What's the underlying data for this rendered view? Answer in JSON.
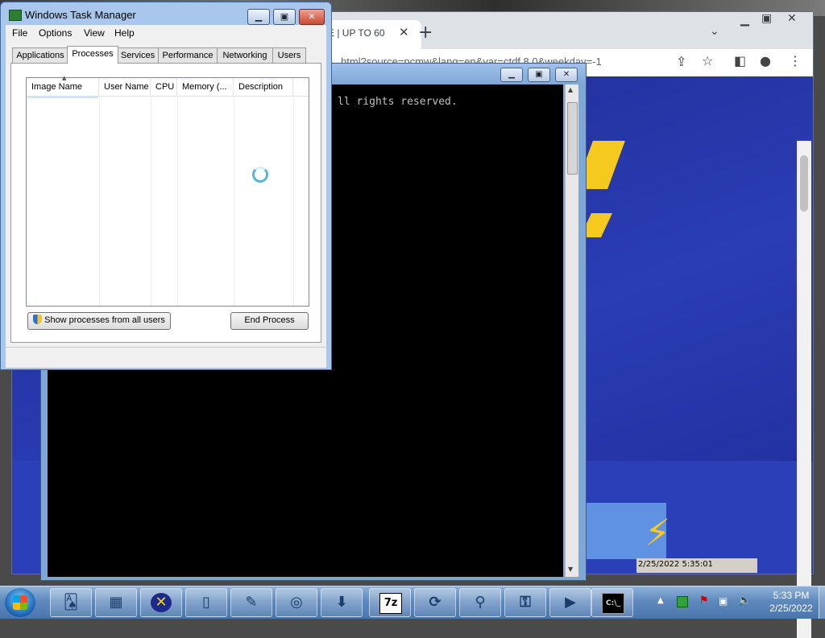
{
  "taskmanager": {
    "title": "Windows Task Manager",
    "menu": [
      "File",
      "Options",
      "View",
      "Help"
    ],
    "tabs": [
      "Applications",
      "Processes",
      "Services",
      "Performance",
      "Networking",
      "Users"
    ],
    "active_tab": "Processes",
    "columns": [
      "Image Name",
      "User Name",
      "CPU",
      "Memory (...",
      "Description"
    ],
    "show_all_label": "Show processes from all users",
    "end_process_label": "End Process"
  },
  "browser": {
    "tab_title": "E | UP TO 60",
    "url": "html?source=pcmw&lang=en&var=ctdf.8.0&weekday=-1"
  },
  "cmd": {
    "text": "ll rights reserved."
  },
  "statusline": {
    "text": "2/25/2022 5:35:01"
  },
  "taskbar": {
    "time": "5:33 PM",
    "date": "2/25/2022",
    "apps": [
      {
        "name": "solitaire-icon",
        "glyph": "🂡"
      },
      {
        "name": "security-center-icon",
        "glyph": "▦"
      },
      {
        "name": "xming-icon",
        "glyph": "✕"
      },
      {
        "name": "documents-icon",
        "glyph": "▯"
      },
      {
        "name": "notepad-plus-icon",
        "glyph": "✎"
      },
      {
        "name": "tool-icon",
        "glyph": "◎"
      },
      {
        "name": "downloader-icon",
        "glyph": "⬇"
      },
      {
        "name": "seven-zip-icon",
        "glyph": "7z"
      },
      {
        "name": "sync-icon",
        "glyph": "⟳"
      },
      {
        "name": "magnifier-icon",
        "glyph": "⚲"
      },
      {
        "name": "remote-icon",
        "glyph": "⚿"
      },
      {
        "name": "media-player-icon",
        "glyph": "▶"
      },
      {
        "name": "cmd-icon",
        "glyph": "C:\\_"
      }
    ]
  },
  "colors": {
    "accent": "#1f6fd0",
    "cmd_bg": "#000000",
    "browser_content": "#2b3db5"
  }
}
